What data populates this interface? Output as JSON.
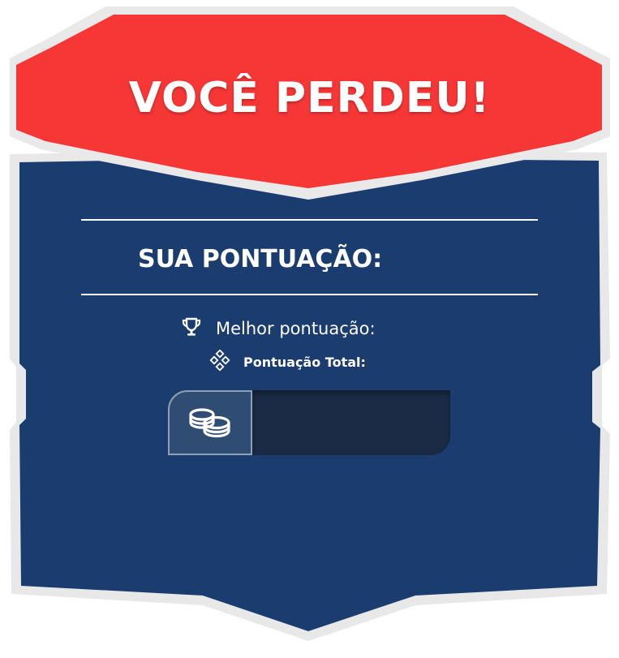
{
  "banner": {
    "title": "VOCÊ PERDEU!",
    "color": "#f73636"
  },
  "panel": {
    "color": "#1b3c6e",
    "border_color": "#e6e6e6"
  },
  "score": {
    "label": "SUA PONTUAÇÃO:",
    "value": ""
  },
  "best_score": {
    "icon": "trophy-icon",
    "label": "Melhor pontuação:",
    "value": ""
  },
  "total_score": {
    "icon": "diamond-grid-icon",
    "label": "Pontuação Total:"
  },
  "coins": {
    "icon": "coins-icon",
    "value": ""
  }
}
